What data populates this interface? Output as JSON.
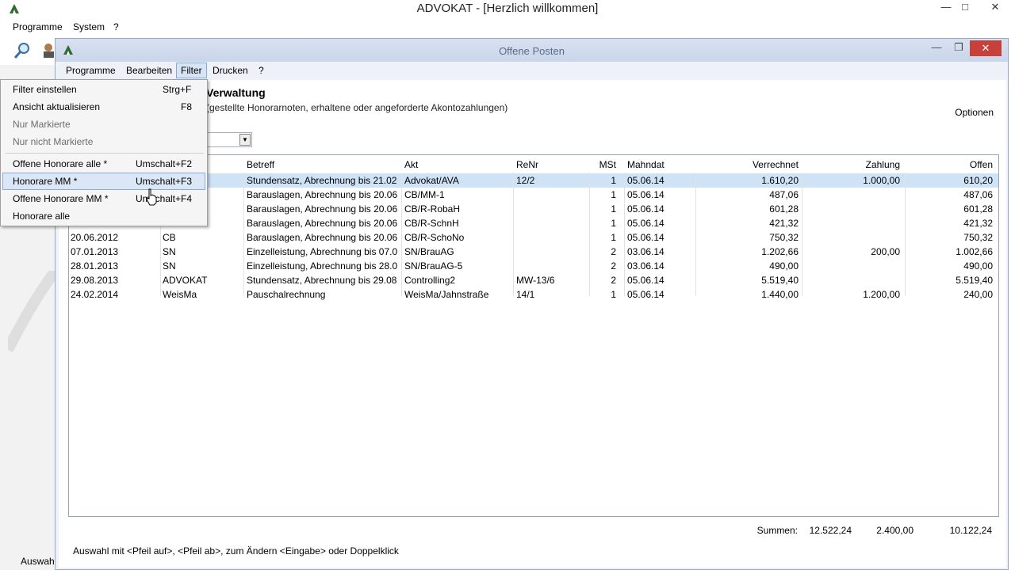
{
  "main_window": {
    "title": "ADVOKAT - [Herzlich willkommen]",
    "menu": [
      "Programme",
      "System",
      "?"
    ],
    "bottom_text": "Auswah"
  },
  "child_window": {
    "title": "Offene Posten",
    "menu": [
      "Programme",
      "Bearbeiten",
      "Filter",
      "Drucken",
      "?"
    ],
    "heading": "Verwaltung",
    "subheading": "(gestellte Honorarnoten, erhaltene oder angeforderte Akontozahlungen)",
    "options_label": "Optionen"
  },
  "table": {
    "columns": [
      "Betreff",
      "Akt",
      "ReNr",
      "MSt",
      "Mahndat",
      "Verrechnet",
      "Zahlung",
      "Offen"
    ],
    "rows": [
      {
        "datum": "",
        "bearbeiter": "",
        "betreff": "Stundensatz, Abrechnung bis 21.02",
        "akt": "Advokat/AVA",
        "renr": "12/2",
        "mst": "1",
        "mahndat": "05.06.14",
        "verrechnet": "1.610,20",
        "zahlung": "1.000,00",
        "offen": "610,20"
      },
      {
        "datum": "",
        "bearbeiter": "",
        "betreff": "Barauslagen, Abrechnung bis 20.06",
        "akt": "CB/MM-1",
        "renr": "",
        "mst": "1",
        "mahndat": "05.06.14",
        "verrechnet": "487,06",
        "zahlung": "",
        "offen": "487,06"
      },
      {
        "datum": "",
        "bearbeiter": "",
        "betreff": "Barauslagen, Abrechnung bis 20.06",
        "akt": "CB/R-RobaH",
        "renr": "",
        "mst": "1",
        "mahndat": "05.06.14",
        "verrechnet": "601,28",
        "zahlung": "",
        "offen": "601,28"
      },
      {
        "datum": "",
        "bearbeiter": "",
        "betreff": "Barauslagen, Abrechnung bis 20.06",
        "akt": "CB/R-SchnH",
        "renr": "",
        "mst": "1",
        "mahndat": "05.06.14",
        "verrechnet": "421,32",
        "zahlung": "",
        "offen": "421,32"
      },
      {
        "datum": "20.06.2012",
        "bearbeiter": "CB",
        "betreff": "Barauslagen, Abrechnung bis 20.06",
        "akt": "CB/R-SchoNo",
        "renr": "",
        "mst": "1",
        "mahndat": "05.06.14",
        "verrechnet": "750,32",
        "zahlung": "",
        "offen": "750,32"
      },
      {
        "datum": "07.01.2013",
        "bearbeiter": "SN",
        "betreff": "Einzelleistung, Abrechnung bis 07.0",
        "akt": "SN/BrauAG",
        "renr": "",
        "mst": "2",
        "mahndat": "03.06.14",
        "verrechnet": "1.202,66",
        "zahlung": "200,00",
        "offen": "1.002,66"
      },
      {
        "datum": "28.01.2013",
        "bearbeiter": "SN",
        "betreff": "Einzelleistung, Abrechnung bis 28.0",
        "akt": "SN/BrauAG-5",
        "renr": "",
        "mst": "2",
        "mahndat": "03.06.14",
        "verrechnet": "490,00",
        "zahlung": "",
        "offen": "490,00"
      },
      {
        "datum": "29.08.2013",
        "bearbeiter": "ADVOKAT",
        "betreff": "Stundensatz, Abrechnung bis 29.08",
        "akt": "Controlling2",
        "renr": "MW-13/6",
        "mst": "2",
        "mahndat": "05.06.14",
        "verrechnet": "5.519,40",
        "zahlung": "",
        "offen": "5.519,40"
      },
      {
        "datum": "24.02.2014",
        "bearbeiter": "WeisMa",
        "betreff": "Pauschalrechnung",
        "akt": "WeisMa/Jahnstraße",
        "renr": "14/1",
        "mst": "1",
        "mahndat": "05.06.14",
        "verrechnet": "1.440,00",
        "zahlung": "1.200,00",
        "offen": "240,00"
      }
    ],
    "summary": {
      "label": "Summen:",
      "verrechnet": "12.522,24",
      "zahlung": "2.400,00",
      "offen": "10.122,24"
    }
  },
  "statusbar": "Auswahl mit <Pfeil auf>, <Pfeil ab>,  zum Ändern <Eingabe> oder Doppelklick",
  "filter_menu": {
    "items": [
      {
        "label": "Filter einstellen",
        "shortcut": "Strg+F"
      },
      {
        "label": "Ansicht aktualisieren",
        "shortcut": "F8"
      },
      {
        "label": "Nur Markierte",
        "shortcut": ""
      },
      {
        "label": "Nur nicht Markierte",
        "shortcut": ""
      },
      {
        "label": "Offene Honorare alle *",
        "shortcut": "Umschalt+F2"
      },
      {
        "label": "Honorare MM *",
        "shortcut": "Umschalt+F3"
      },
      {
        "label": "Offene Honorare MM *",
        "shortcut": "Umschalt+F4"
      },
      {
        "label": "Honorare alle",
        "shortcut": ""
      }
    ]
  }
}
